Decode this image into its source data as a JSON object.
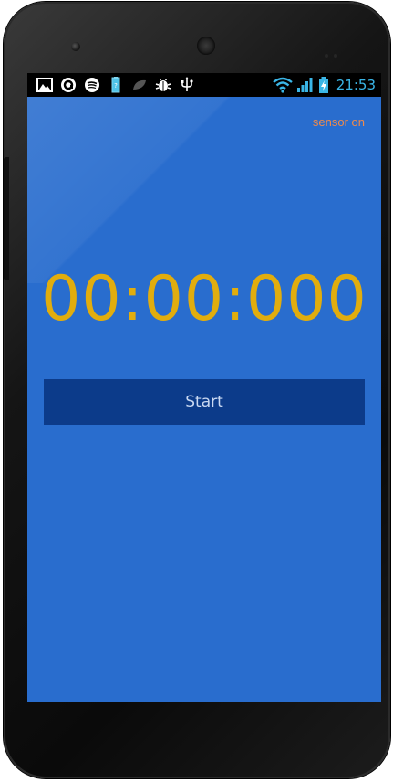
{
  "status_bar": {
    "time": "21:53",
    "left_icons": [
      "gallery-icon",
      "circle-app-icon",
      "spotify-icon",
      "battery-indicator-icon",
      "leaf-icon",
      "android-debug-icon",
      "usb-icon"
    ],
    "right_icons": [
      "wifi-icon",
      "cell-signal-icon",
      "battery-charging-icon"
    ]
  },
  "app": {
    "sensor_status": "sensor on",
    "timer_display": "00:00:000",
    "start_button_label": "Start"
  },
  "colors": {
    "screen_background": "#296dce",
    "timer_text": "#e1ad0e",
    "sensor_text": "#f08a4b",
    "button_background": "#0c3b8a",
    "button_text": "#c9d8f2",
    "clock_text": "#3ab5e6"
  }
}
